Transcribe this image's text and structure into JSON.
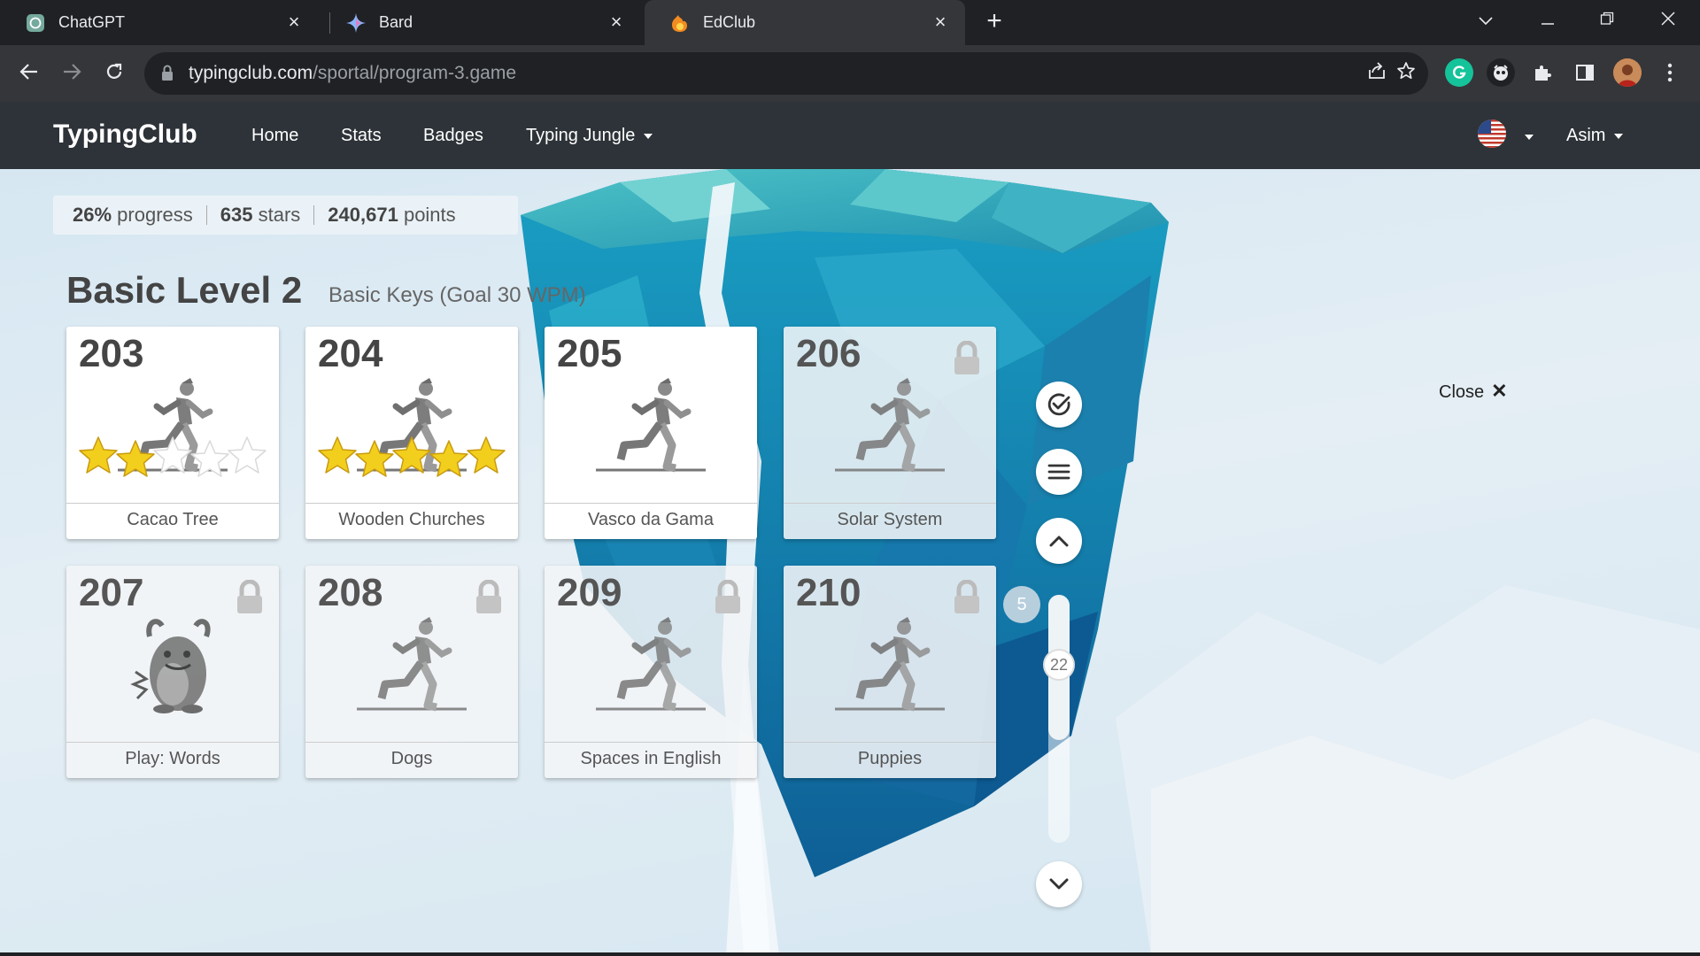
{
  "browser": {
    "tabs": [
      {
        "title": "ChatGPT",
        "icon": "chatgpt-icon",
        "active": false
      },
      {
        "title": "Bard",
        "icon": "bard-icon",
        "active": false
      },
      {
        "title": "EdClub",
        "icon": "edclub-icon",
        "active": true
      }
    ],
    "url_host": "typingclub.com",
    "url_path": "/sportal/program-3.game"
  },
  "header": {
    "logo": "TypingClub",
    "nav": [
      "Home",
      "Stats",
      "Badges",
      "Typing Jungle"
    ],
    "user": "Asim"
  },
  "stats": {
    "progress_value": "26%",
    "progress_label": "progress",
    "stars_value": "635",
    "stars_label": "stars",
    "points_value": "240,671",
    "points_label": "points"
  },
  "level": {
    "title": "Basic Level 2",
    "subtitle": "Basic Keys (Goal 30 WPM)"
  },
  "lessons": [
    {
      "number": "203",
      "name": "Cacao Tree",
      "stars": 2,
      "locked": false,
      "icon": "runner-icon"
    },
    {
      "number": "204",
      "name": "Wooden Churches",
      "stars": 5,
      "locked": false,
      "icon": "runner-icon"
    },
    {
      "number": "205",
      "name": "Vasco da Gama",
      "stars": 0,
      "locked": false,
      "icon": "runner-icon"
    },
    {
      "number": "206",
      "name": "Solar System",
      "stars": 0,
      "locked": true,
      "icon": "runner-icon"
    },
    {
      "number": "207",
      "name": "Play: Words",
      "stars": 0,
      "locked": true,
      "icon": "monster-icon"
    },
    {
      "number": "208",
      "name": "Dogs",
      "stars": 0,
      "locked": true,
      "icon": "runner-icon"
    },
    {
      "number": "209",
      "name": "Spaces in English",
      "stars": 0,
      "locked": true,
      "icon": "runner-icon"
    },
    {
      "number": "210",
      "name": "Puppies",
      "stars": 0,
      "locked": true,
      "icon": "runner-icon"
    }
  ],
  "slider": {
    "min_label": "5",
    "current_label": "22"
  },
  "close_label": "Close"
}
